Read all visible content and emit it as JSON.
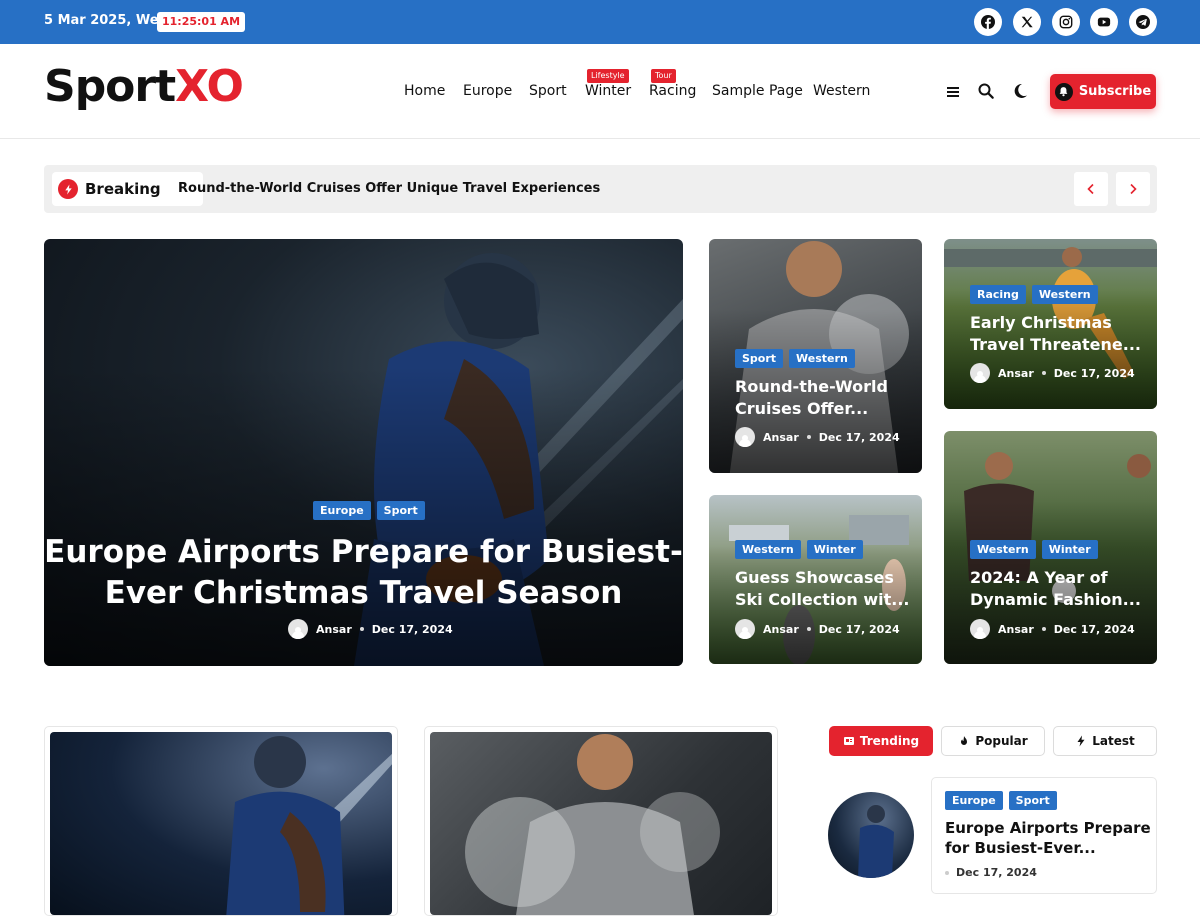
{
  "topbar": {
    "date": "5 Mar 2025, Wed",
    "time": "11:25:01 AM",
    "social": [
      {
        "icon": "facebook-icon"
      },
      {
        "icon": "x-icon"
      },
      {
        "icon": "instagram-icon"
      },
      {
        "icon": "youtube-icon"
      },
      {
        "icon": "telegram-icon"
      }
    ]
  },
  "header": {
    "logo_main": "Sport",
    "logo_accent": "XO",
    "nav": [
      {
        "label": "Home"
      },
      {
        "label": "Europe"
      },
      {
        "label": "Sport"
      },
      {
        "label": "Winter",
        "badge": "Lifestyle"
      },
      {
        "label": "Racing",
        "badge": "Tour"
      },
      {
        "label": "Sample Page"
      },
      {
        "label": "Western"
      }
    ],
    "subscribe_label": "Subscribe"
  },
  "breaking": {
    "label": "Breaking",
    "headline": "Round-the-World Cruises Offer Unique Travel Experiences"
  },
  "hero": {
    "tags": [
      "Europe",
      "Sport"
    ],
    "title_line1": "Europe Airports Prepare for Busiest-",
    "title_line2": "Ever Christmas Travel Season",
    "author": "Ansar",
    "date": "Dec 17, 2024"
  },
  "cards": [
    {
      "tags": [
        "Sport",
        "Western"
      ],
      "title_line1": "Round-the-World",
      "title_line2": "Cruises Offer...",
      "author": "Ansar",
      "date": "Dec 17, 2024"
    },
    {
      "tags": [
        "Racing",
        "Western"
      ],
      "title_line1": "Early Christmas",
      "title_line2": "Travel Threatene...",
      "author": "Ansar",
      "date": "Dec 17, 2024"
    },
    {
      "tags": [
        "Western",
        "Winter"
      ],
      "title_line1": "Guess Showcases",
      "title_line2": "Ski Collection wit...",
      "author": "Ansar",
      "date": "Dec 17, 2024"
    },
    {
      "tags": [
        "Western",
        "Winter"
      ],
      "title_line1": "2024: A Year of",
      "title_line2": "Dynamic Fashion...",
      "author": "Ansar",
      "date": "Dec 17, 2024"
    }
  ],
  "tabs": [
    {
      "label": "Trending",
      "icon": "trending-icon",
      "active": true
    },
    {
      "label": "Popular",
      "icon": "fire-icon",
      "active": false
    },
    {
      "label": "Latest",
      "icon": "bolt-icon",
      "active": false
    }
  ],
  "trending": {
    "tags": [
      "Europe",
      "Sport"
    ],
    "title_line1": "Europe Airports Prepare",
    "title_line2": "for Busiest-Ever...",
    "date": "Dec 17, 2024"
  },
  "colors": {
    "brand_red": "#e4232e",
    "brand_blue": "#2770c5"
  }
}
